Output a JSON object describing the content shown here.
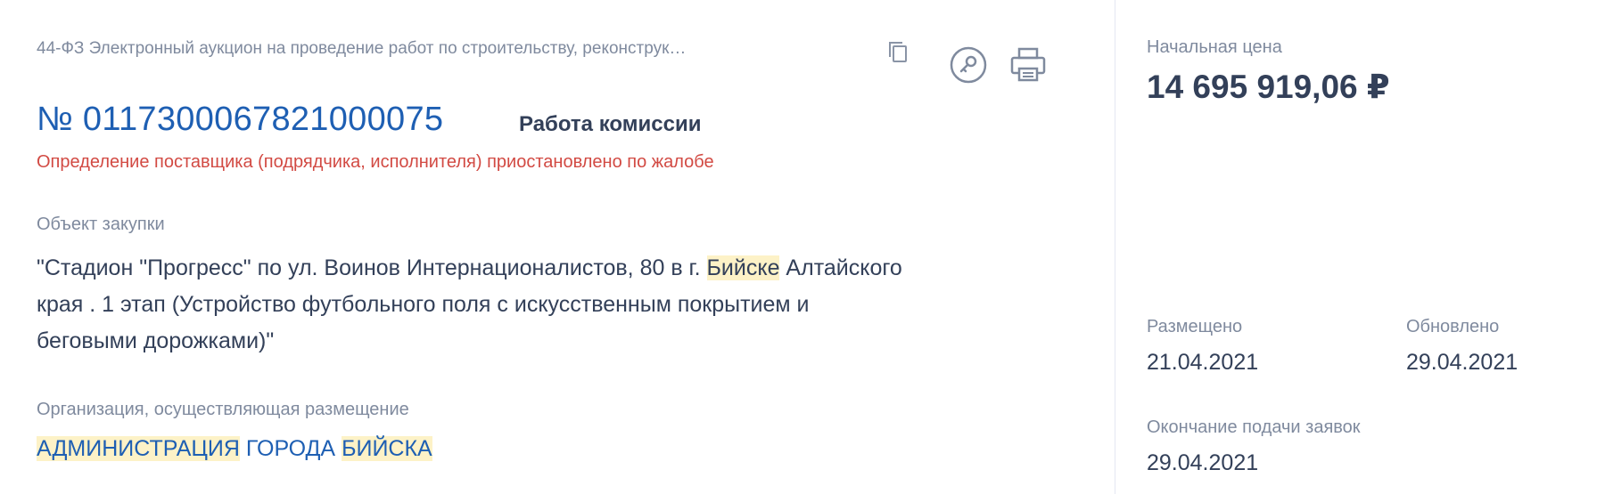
{
  "header": {
    "purchase_type": "44-ФЗ Электронный аукцион на проведение работ по строительству, реконструк…",
    "number": "№ 0117300067821000075",
    "status": "Работа комиссии",
    "warning": "Определение поставщика (подрядчика, исполнителя) приостановлено по жалобе"
  },
  "icons": {
    "copy": "copy-icon",
    "key": "key-icon",
    "print": "printer-icon"
  },
  "object": {
    "label": "Объект закупки",
    "line1_before": "\"Стадион \"Прогресс\" по ул. Воинов Интернационалистов, 80 в г. ",
    "line1_highlight": "Бийске",
    "line1_after": " Алтайского",
    "line2": "края . 1 этап (Устройство футбольного поля с искусственным покрытием и",
    "line3": "беговыми дорожками)\""
  },
  "organization": {
    "label": "Организация, осуществляющая размещение",
    "word1": "АДМИНИСТРАЦИЯ",
    "word2": " ГОРОДА ",
    "word3": "БИЙСКА"
  },
  "summary": {
    "price_label": "Начальная цена",
    "price": "14 695 919,06 ₽",
    "placed_label": "Размещено",
    "placed_date": "21.04.2021",
    "updated_label": "Обновлено",
    "updated_date": "29.04.2021",
    "deadline_label": "Окончание подачи заявок",
    "deadline_date": "29.04.2021"
  },
  "colors": {
    "accent": "#1e5fb3",
    "warning": "#d24a43",
    "highlight": "#fdf2c7",
    "muted": "#7f8a9e",
    "text": "#334059"
  }
}
